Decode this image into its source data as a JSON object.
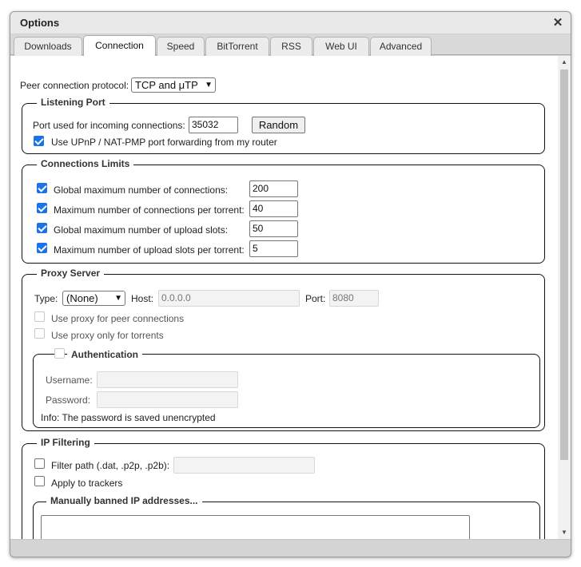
{
  "window": {
    "title": "Options"
  },
  "tabs": [
    {
      "label": "Downloads"
    },
    {
      "label": "Connection"
    },
    {
      "label": "Speed"
    },
    {
      "label": "BitTorrent"
    },
    {
      "label": "RSS"
    },
    {
      "label": "Web UI"
    },
    {
      "label": "Advanced"
    }
  ],
  "protocol": {
    "label": "Peer connection protocol:",
    "value": "TCP and μTP"
  },
  "listening": {
    "legend": "Listening Port",
    "port_label": "Port used for incoming connections:",
    "port_value": "35032",
    "random_label": "Random",
    "upnp_label": "Use UPnP / NAT-PMP port forwarding from my router",
    "upnp_checked": true
  },
  "limits": {
    "legend": "Connections Limits",
    "rows": [
      {
        "label": "Global maximum number of connections:",
        "value": "200",
        "checked": true
      },
      {
        "label": "Maximum number of connections per torrent:",
        "value": "40",
        "checked": true
      },
      {
        "label": "Global maximum number of upload slots:",
        "value": "50",
        "checked": true
      },
      {
        "label": "Maximum number of upload slots per torrent:",
        "value": "5",
        "checked": true
      }
    ]
  },
  "proxy": {
    "legend": "Proxy Server",
    "type_label": "Type:",
    "type_value": "(None)",
    "host_label": "Host:",
    "host_value": "0.0.0.0",
    "port_label": "Port:",
    "port_value": "8080",
    "peer_label": "Use proxy for peer connections",
    "torrents_label": "Use proxy only for torrents",
    "auth": {
      "legend": "Authentication",
      "username_label": "Username:",
      "password_label": "Password:",
      "info": "Info: The password is saved unencrypted"
    }
  },
  "ipfilter": {
    "legend": "IP Filtering",
    "path_label": "Filter path (.dat, .p2p, .p2b):",
    "trackers_label": "Apply to trackers",
    "banned_legend": "Manually banned IP addresses..."
  },
  "colors": {
    "accent": "#1a73e8",
    "border": "#111111",
    "chrome": "#d4d4d4"
  }
}
